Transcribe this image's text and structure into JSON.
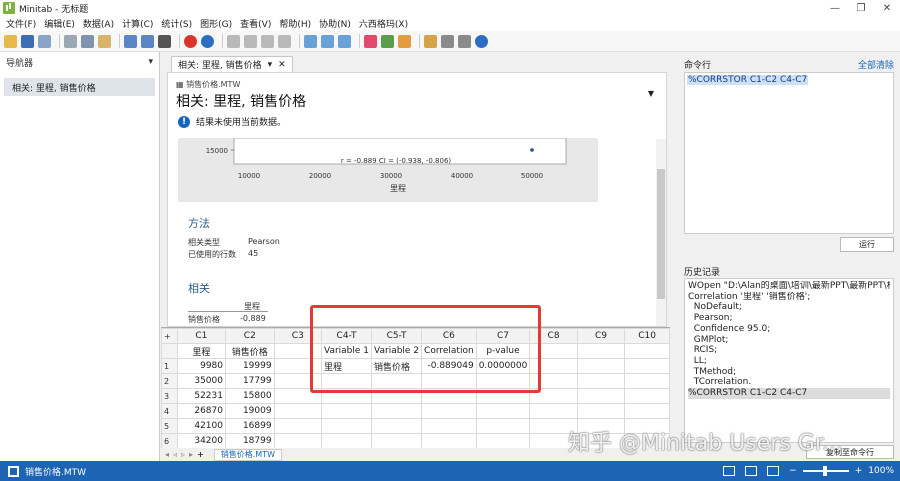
{
  "window": {
    "title": "Minitab - 无标题",
    "controls": [
      "—",
      "❐",
      "✕"
    ]
  },
  "menu": [
    "文件(F)",
    "编辑(E)",
    "数据(A)",
    "计算(C)",
    "统计(S)",
    "图形(G)",
    "查看(V)",
    "帮助(H)",
    "协助(N)",
    "六西格玛(X)"
  ],
  "navigator": {
    "title": "导航器",
    "items": [
      "相关: 里程, 销售价格"
    ]
  },
  "output": {
    "tab_label": "相关: 里程, 销售价格",
    "tab_menu": "▾",
    "tab_close": "✕",
    "file_name": "销售价格.MTW",
    "title": "相关: 里程, 销售价格",
    "notice": "结果未使用当前数据。",
    "plot": {
      "y_tick": "15000",
      "x_ticks": [
        "10000",
        "20000",
        "30000",
        "40000",
        "50000"
      ],
      "annotation": "r = -0.889  CI = (-0.938, -0.806)",
      "xlabel": "里程"
    },
    "method_title": "方法",
    "method_rows": [
      {
        "key": "相关类型",
        "value": "Pearson"
      },
      {
        "key": "已使用的行数",
        "value": "45"
      }
    ],
    "corr_title": "相关",
    "corr_header": "里程",
    "corr_row_label": "销售价格",
    "corr_value": "-0.889"
  },
  "worksheet": {
    "columns": [
      "C1",
      "C2",
      "C3",
      "C4-T",
      "C5-T",
      "C6",
      "C7",
      "C8",
      "C9",
      "C10"
    ],
    "names": [
      "里程",
      "销售价格",
      "",
      "Variable 1",
      "Variable 2",
      "Correlation",
      "p-value",
      "",
      "",
      ""
    ],
    "rows": [
      [
        "9980",
        "19999",
        "",
        "里程",
        "销售价格",
        "-0.889049",
        "0.0000000",
        "",
        "",
        ""
      ],
      [
        "35000",
        "17799",
        "",
        "",
        "",
        "",
        "",
        "",
        "",
        ""
      ],
      [
        "52231",
        "15800",
        "",
        "",
        "",
        "",
        "",
        "",
        "",
        ""
      ],
      [
        "26870",
        "19009",
        "",
        "",
        "",
        "",
        "",
        "",
        "",
        ""
      ],
      [
        "42100",
        "16899",
        "",
        "",
        "",
        "",
        "",
        "",
        "",
        ""
      ],
      [
        "34200",
        "18799",
        "",
        "",
        "",
        "",
        "",
        "",
        "",
        ""
      ]
    ],
    "sheet_tab": "销售价格.MTW"
  },
  "command": {
    "title": "命令行",
    "clear_all": "全部清除",
    "current": "%CORRSTOR C1-C2 C4-C7",
    "run": "运行"
  },
  "history": {
    "title": "历史记录",
    "lines": [
      "WOpen \"D:\\Alan的桌面\\培训\\最新PPT\\最新PPT\\相关\\",
      "Correlation '里程' '销售价格';",
      "  NoDefault;",
      "  Pearson;",
      "  Confidence 95.0;",
      "  GMPlot;",
      "  RCIS;",
      "  LL;",
      "  TMethod;",
      "  TCorrelation.",
      "%CORRSTOR C1-C2 C4-C7"
    ],
    "copy_button": "复制至命令行"
  },
  "status": {
    "file": "销售价格.MTW",
    "zoom": "100%",
    "minus": "−",
    "plus": "+"
  },
  "watermark": "知乎 @Minitab Users Gr..."
}
